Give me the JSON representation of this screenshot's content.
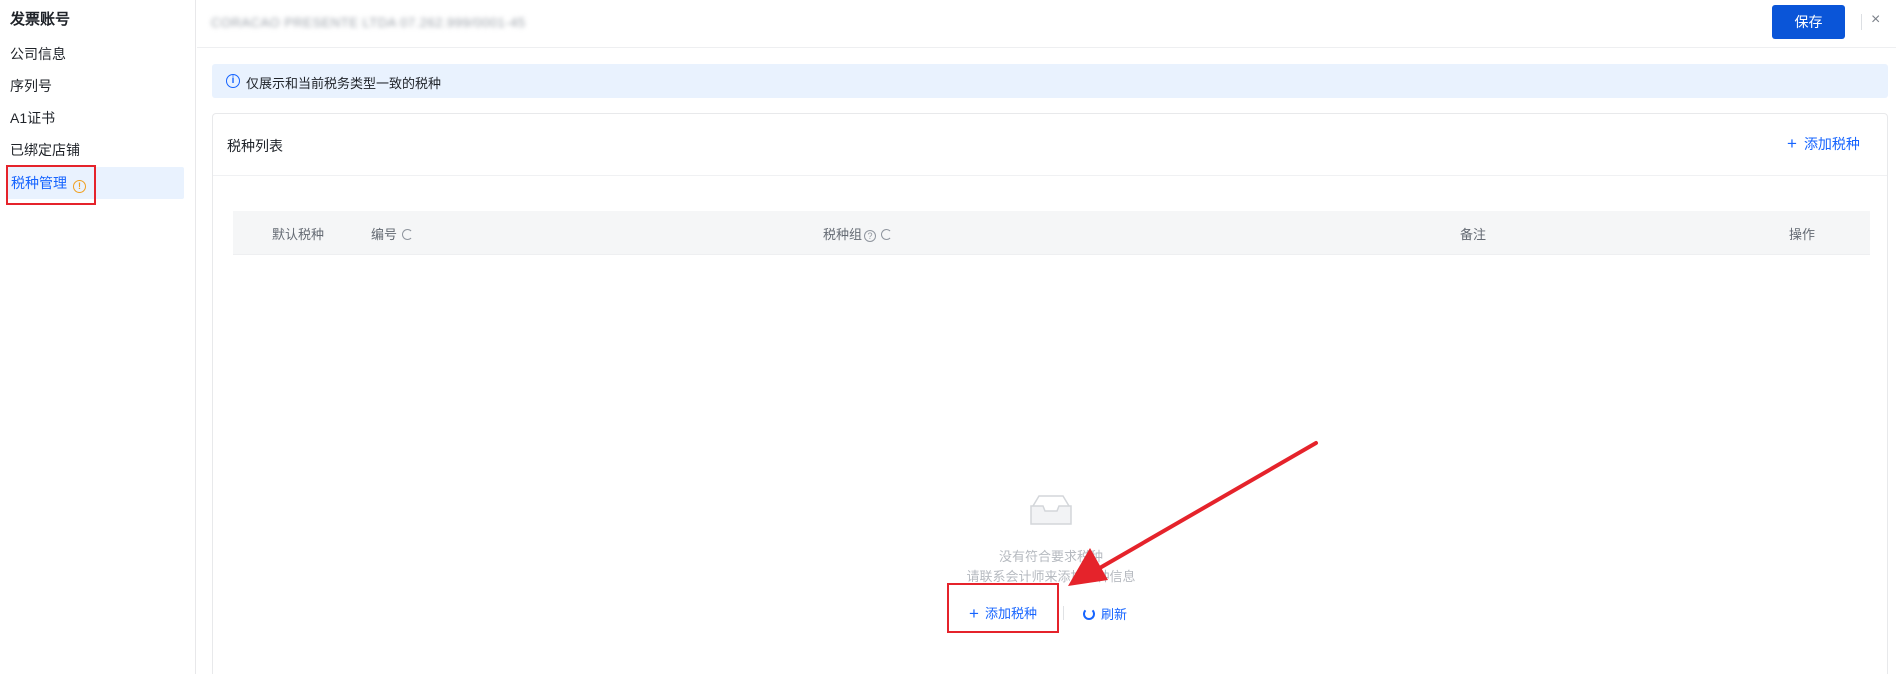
{
  "sidebar": {
    "title": "发票账号",
    "items": [
      {
        "label": "公司信息"
      },
      {
        "label": "序列号"
      },
      {
        "label": "A1证书"
      },
      {
        "label": "已绑定店铺"
      },
      {
        "label": "税种管理",
        "active": true
      }
    ]
  },
  "topbar": {
    "company": "CORACAO PRESENTE LTDA  07.262.999/0001-45",
    "save_label": "保存",
    "close_icon": "×"
  },
  "banner": {
    "text": "仅展示和当前税务类型一致的税种"
  },
  "card": {
    "title": "税种列表",
    "add_label": "添加税种",
    "columns": [
      "默认税种",
      "编号",
      "税种组",
      "备注",
      "操作"
    ],
    "empty": {
      "line1": "没有符合要求税种",
      "line2": "请联系会计师来添加税种信息",
      "add_label": "添加税种",
      "refresh_label": "刷新"
    }
  },
  "colors": {
    "primary": "#1664ff",
    "save_button": "#0a55d8",
    "highlight": "#e5232b",
    "banner_bg": "#e9f2fe"
  }
}
